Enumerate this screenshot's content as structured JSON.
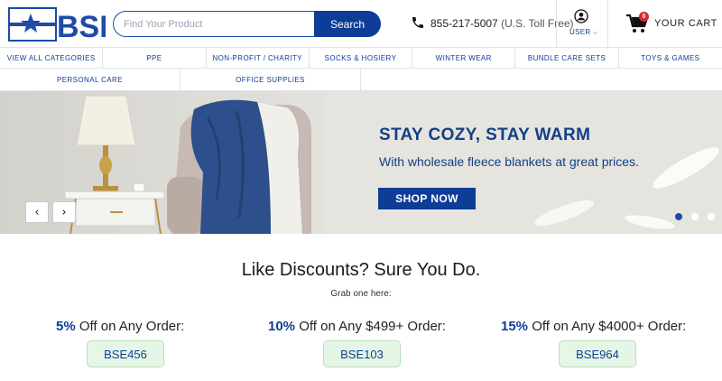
{
  "header": {
    "logo_text": "BSE",
    "search": {
      "placeholder": "Find Your Product",
      "value": "",
      "button_label": "Search"
    },
    "phone": {
      "number": "855-217-5007",
      "note": "(U.S. Toll Free)"
    },
    "user_label": "USER",
    "cart": {
      "badge_count": "0",
      "label": "YOUR CART"
    }
  },
  "nav": {
    "row1": [
      "VIEW ALL CATEGORIES",
      "PPE",
      "NON-PROFIT / CHARITY",
      "SOCKS & HOSIERY",
      "WINTER WEAR",
      "BUNDLE CARE SETS",
      "TOYS & GAMES"
    ],
    "row2": [
      "PERSONAL CARE",
      "OFFICE SUPPLIES"
    ]
  },
  "hero": {
    "title": "STAY COZY, STAY WARM",
    "subtitle": "With wholesale fleece blankets at great prices.",
    "cta_label": "SHOP NOW",
    "prev_symbol": "‹",
    "next_symbol": "›",
    "slide_count": 3,
    "active_slide": 1
  },
  "discounts": {
    "title": "Like Discounts? Sure You Do.",
    "subtitle": "Grab one here:",
    "offers": [
      {
        "percent": "5%",
        "text": " Off on Any Order:",
        "code": "BSE456"
      },
      {
        "percent": "10%",
        "text": " Off on Any $499+ Order:",
        "code": "BSE103"
      },
      {
        "percent": "15%",
        "text": " Off on Any $4000+ Order:",
        "code": "BSE964"
      }
    ]
  },
  "colors": {
    "brand_blue": "#0e3d97",
    "cart_badge": "#d7262e",
    "code_bg": "#e6f6e6"
  },
  "icons": [
    "bse-logo",
    "phone-icon",
    "user-icon",
    "chevron-down-icon",
    "cart-icon"
  ]
}
